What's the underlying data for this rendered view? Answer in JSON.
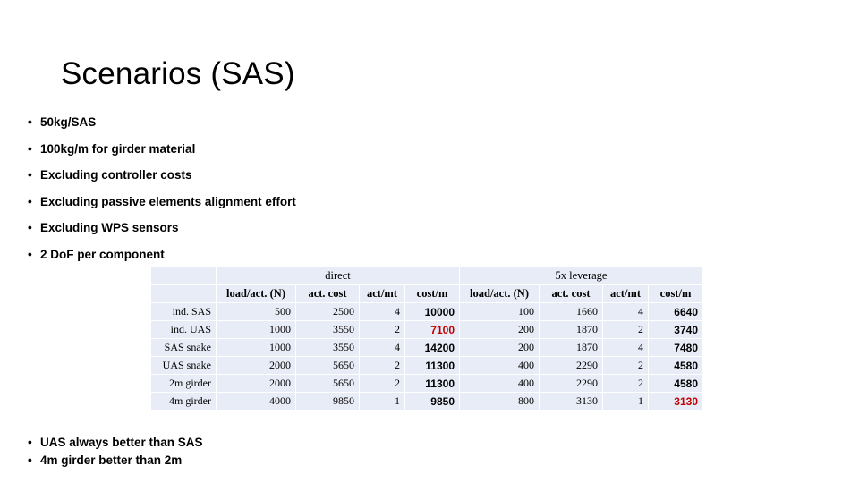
{
  "slide": {
    "title": "Scenarios (SAS)"
  },
  "assumptions": {
    "bullet_marker": "•",
    "items": [
      "50kg/SAS",
      "100kg/m for girder material",
      "Excluding controller costs",
      "Excluding passive elements alignment effort",
      "Excluding WPS sensors",
      "2 DoF per component"
    ]
  },
  "conclusions": {
    "bullet_marker": "•",
    "items": [
      "UAS always better than SAS",
      "4m girder better than 2m"
    ]
  },
  "table": {
    "corner_label": "",
    "group_headers": [
      {
        "label": "",
        "span": 1
      },
      {
        "label": "direct",
        "span": 4
      },
      {
        "label": "5x leverage",
        "span": 4
      }
    ],
    "sub_headers": [
      "",
      "load/act. (N)",
      "act. cost",
      "act/mt",
      "cost/m",
      "load/act. (N)",
      "act. cost",
      "act/mt",
      "cost/m"
    ],
    "highlight_color": "#c00000",
    "cell_background": "#e7ecf6",
    "rows": [
      {
        "label": "ind. SAS",
        "direct": {
          "load_act_n": "500",
          "act_cost": "2500",
          "act_mt": "4",
          "cost_m": "10000",
          "cost_m_highlight": false
        },
        "leverage": {
          "load_act_n": "100",
          "act_cost": "1660",
          "act_mt": "4",
          "cost_m": "6640",
          "cost_m_highlight": false
        }
      },
      {
        "label": "ind. UAS",
        "direct": {
          "load_act_n": "1000",
          "act_cost": "3550",
          "act_mt": "2",
          "cost_m": "7100",
          "cost_m_highlight": true
        },
        "leverage": {
          "load_act_n": "200",
          "act_cost": "1870",
          "act_mt": "2",
          "cost_m": "3740",
          "cost_m_highlight": false
        }
      },
      {
        "label": "SAS snake",
        "direct": {
          "load_act_n": "1000",
          "act_cost": "3550",
          "act_mt": "4",
          "cost_m": "14200",
          "cost_m_highlight": false
        },
        "leverage": {
          "load_act_n": "200",
          "act_cost": "1870",
          "act_mt": "4",
          "cost_m": "7480",
          "cost_m_highlight": false
        }
      },
      {
        "label": "UAS snake",
        "direct": {
          "load_act_n": "2000",
          "act_cost": "5650",
          "act_mt": "2",
          "cost_m": "11300",
          "cost_m_highlight": false
        },
        "leverage": {
          "load_act_n": "400",
          "act_cost": "2290",
          "act_mt": "2",
          "cost_m": "4580",
          "cost_m_highlight": false
        }
      },
      {
        "label": "2m girder",
        "direct": {
          "load_act_n": "2000",
          "act_cost": "5650",
          "act_mt": "2",
          "cost_m": "11300",
          "cost_m_highlight": false
        },
        "leverage": {
          "load_act_n": "400",
          "act_cost": "2290",
          "act_mt": "2",
          "cost_m": "4580",
          "cost_m_highlight": false
        }
      },
      {
        "label": "4m girder",
        "direct": {
          "load_act_n": "4000",
          "act_cost": "9850",
          "act_mt": "1",
          "cost_m": "9850",
          "cost_m_highlight": false
        },
        "leverage": {
          "load_act_n": "800",
          "act_cost": "3130",
          "act_mt": "1",
          "cost_m": "3130",
          "cost_m_highlight": true
        }
      }
    ]
  }
}
